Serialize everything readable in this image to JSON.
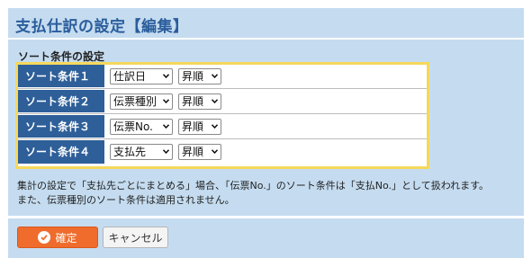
{
  "page": {
    "title": "支払仕訳の設定【編集】"
  },
  "sort_section": {
    "title": "ソート条件の設定",
    "rows": [
      {
        "label": "ソート条件１",
        "field": "仕訳日",
        "order": "昇順"
      },
      {
        "label": "ソート条件２",
        "field": "伝票種別",
        "order": "昇順"
      },
      {
        "label": "ソート条件３",
        "field": "伝票No.",
        "order": "昇順"
      },
      {
        "label": "ソート条件４",
        "field": "支払先",
        "order": "昇順"
      }
    ]
  },
  "note": {
    "line1": "集計の設定で「支払先ごとにまとめる」場合、「伝票No.」のソート条件は「支払No.」として扱われます。",
    "line2": "また、伝票種別のソート条件は適用されません。"
  },
  "buttons": {
    "confirm": "確定",
    "cancel": "キャンセル"
  },
  "colors": {
    "accent": "#2b5d9c",
    "row_label_bg": "#2e5f99",
    "table_border": "#f5d85c",
    "confirm_bg": "#ef6c2c",
    "panel_bg": "#c5dcf0"
  },
  "icons": {
    "confirm": "check-circle-icon",
    "dropdown": "chevron-down-icon"
  }
}
